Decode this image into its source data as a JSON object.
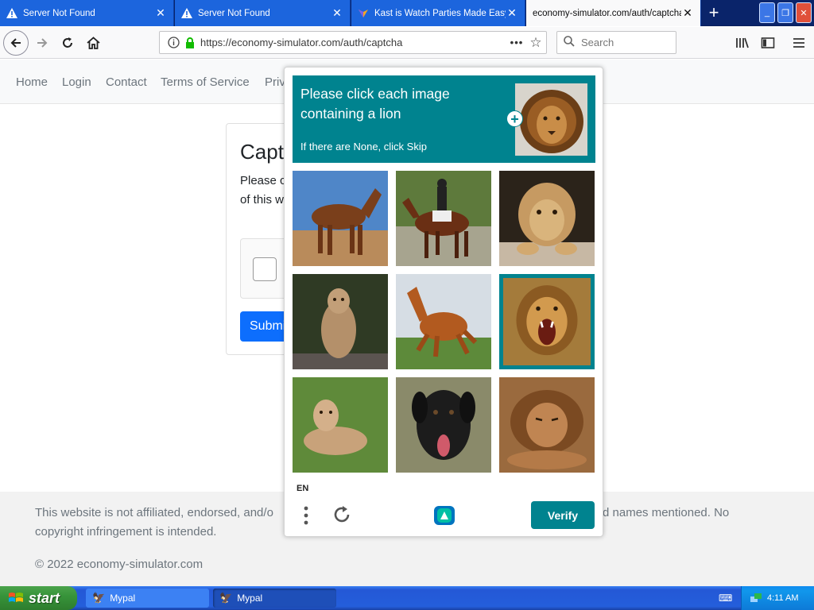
{
  "browser": {
    "tabs": [
      {
        "label": "Server Not Found",
        "icon": "warning-icon",
        "active": false
      },
      {
        "label": "Server Not Found",
        "icon": "warning-icon",
        "active": false
      },
      {
        "label": "Kast is Watch Parties Made Easy",
        "icon": "kast-icon",
        "active": false
      },
      {
        "label": "economy-simulator.com/auth/captcha",
        "icon": "",
        "active": true
      }
    ],
    "url": "https://economy-simulator.com/auth/captcha",
    "search_placeholder": "Search"
  },
  "site": {
    "nav": [
      "Home",
      "Login",
      "Contact",
      "Terms of Service",
      "Priv"
    ],
    "card": {
      "title": "Capt",
      "text": "Please c\nof this w",
      "submit_label": "Submi"
    },
    "footer": {
      "text": "This website is not affiliated, endorsed, and/or                                                                                             d names mentioned. No copyright infringement is intended.",
      "text_left": "This website is not affiliated, endorsed, and/o",
      "text_right": "d names mentioned. No",
      "text_line2": "copyright infringement is intended.",
      "copyright": "© 2022 economy-simulator.com"
    }
  },
  "captcha": {
    "prompt": "Please click each image containing a lion",
    "sub": "If there are None, click Skip",
    "language": "EN",
    "verify_label": "Verify",
    "accent": "#00838f",
    "tiles": [
      {
        "subject": "horse",
        "selected": false
      },
      {
        "subject": "horse",
        "selected": false
      },
      {
        "subject": "lion",
        "selected": false
      },
      {
        "subject": "lion",
        "selected": false
      },
      {
        "subject": "horse",
        "selected": false
      },
      {
        "subject": "lion",
        "selected": true
      },
      {
        "subject": "lion",
        "selected": false
      },
      {
        "subject": "dog",
        "selected": false
      },
      {
        "subject": "lion",
        "selected": false
      }
    ]
  },
  "taskbar": {
    "start_label": "start",
    "tasks": [
      "Mypal",
      "Mypal"
    ],
    "clock": "4:11 AM"
  }
}
